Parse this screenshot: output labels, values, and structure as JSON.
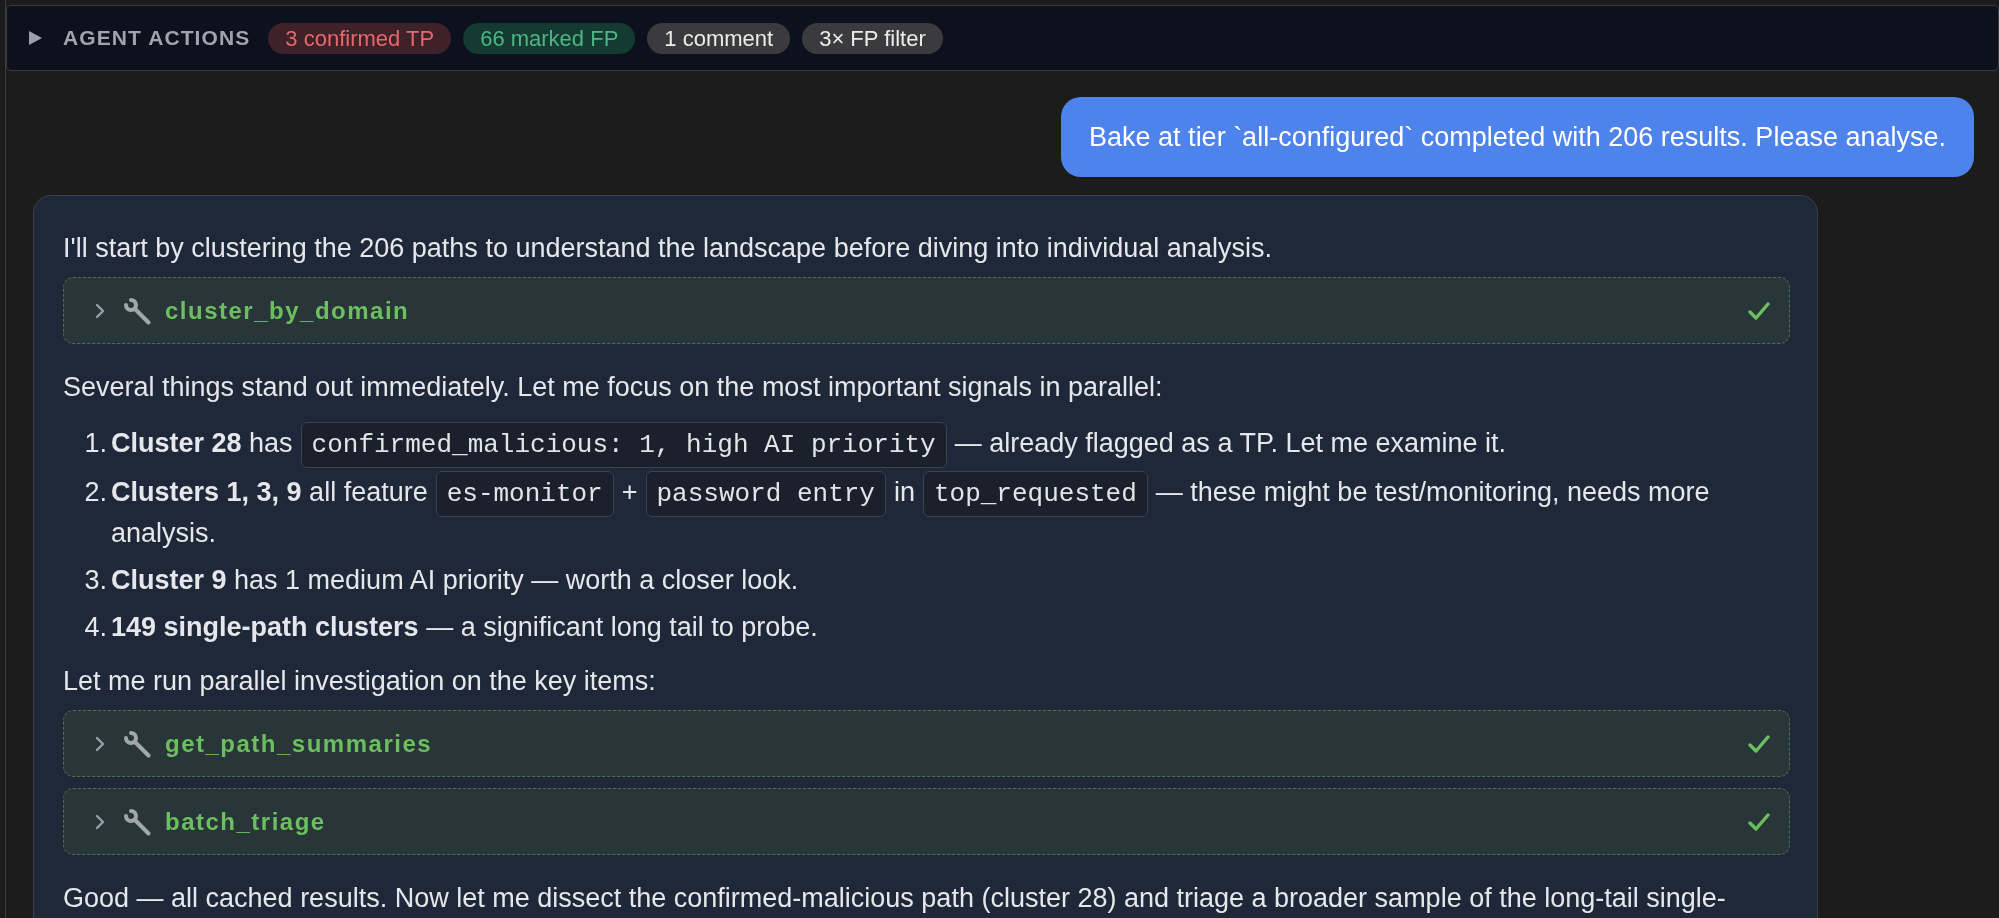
{
  "agent_actions": {
    "title": "AGENT ACTIONS",
    "expanded": false,
    "badges": [
      {
        "label": "3 confirmed TP",
        "kind": "alert"
      },
      {
        "label": "66 marked FP",
        "kind": "ok"
      },
      {
        "label": "1 comment",
        "kind": "neutral"
      },
      {
        "label": "3× FP filter",
        "kind": "neutral"
      }
    ]
  },
  "messages": [
    {
      "kind": "user",
      "text": "Bake at tier `all-configured` completed with 206 results. Please analyse."
    },
    {
      "kind": "assistant",
      "blocks": [
        {
          "kind": "paragraph",
          "text": "I'll start by clustering the 206 paths to understand the landscape before diving into individual analysis."
        },
        {
          "kind": "tool",
          "name": "cluster_by_domain",
          "expanded": false,
          "done": true
        },
        {
          "kind": "paragraph",
          "text": "Several things stand out immediately. Let me focus on the most important signals in parallel:"
        },
        {
          "kind": "list",
          "items": [
            {
              "number": "1.",
              "parts": [
                {
                  "kind": "text",
                  "text": "**Cluster 28** has"
                },
                {
                  "kind": "code",
                  "text": "confirmed_malicious: 1, high AI priority"
                },
                {
                  "kind": "text",
                  "text": "— already flagged as a TP. Let me examine it."
                }
              ]
            },
            {
              "number": "2.",
              "parts": [
                {
                  "kind": "text",
                  "text": "**Clusters 1, 3, 9** all feature"
                },
                {
                  "kind": "code",
                  "text": "es-monitor"
                },
                {
                  "kind": "text",
                  "text": "+"
                },
                {
                  "kind": "code",
                  "text": "password entry"
                },
                {
                  "kind": "text",
                  "text": "in"
                },
                {
                  "kind": "code",
                  "text": "top_requested"
                },
                {
                  "kind": "text",
                  "text": "— these might be test/monitoring, needs more analysis."
                }
              ]
            },
            {
              "number": "3.",
              "parts": [
                {
                  "kind": "text",
                  "text": "**Cluster 9** has 1 medium AI priority — worth a closer look."
                }
              ]
            },
            {
              "number": "4.",
              "parts": [
                {
                  "kind": "text",
                  "text": "**149 single-path clusters** — a significant long tail to probe."
                }
              ]
            }
          ]
        },
        {
          "kind": "paragraph",
          "text": "Let me run parallel investigation on the key items:"
        },
        {
          "kind": "tool",
          "name": "get_path_summaries",
          "expanded": false,
          "done": true
        },
        {
          "kind": "tool",
          "name": "batch_triage",
          "expanded": false,
          "done": true
        },
        {
          "kind": "paragraph",
          "text": "Good — all cached results. Now let me dissect the confirmed-malicious path (cluster 28) and triage a broader sample of the long-tail single-"
        }
      ]
    }
  ]
}
